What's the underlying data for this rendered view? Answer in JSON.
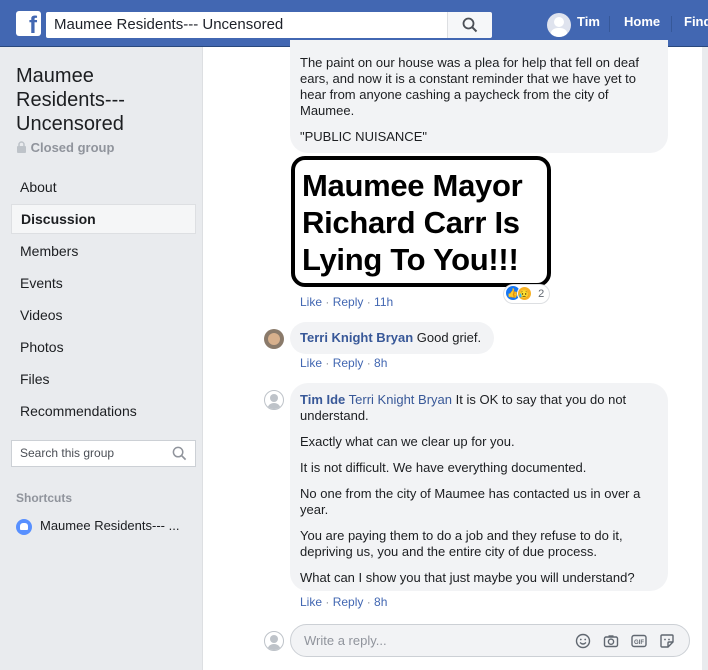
{
  "topbar": {
    "logo": "f",
    "search_value": "Maumee Residents--- Uncensored",
    "user_name": "Tim",
    "nav_home": "Home",
    "nav_find": "Find"
  },
  "sidebar": {
    "group_name": "Maumee Residents--- Uncensored",
    "privacy": "Closed group",
    "items": [
      {
        "label": "About"
      },
      {
        "label": "Discussion"
      },
      {
        "label": "Members"
      },
      {
        "label": "Events"
      },
      {
        "label": "Videos"
      },
      {
        "label": "Photos"
      },
      {
        "label": "Files"
      },
      {
        "label": "Recommendations"
      }
    ],
    "search_placeholder": "Search this group",
    "shortcuts_heading": "Shortcuts",
    "shortcut_item": "Maumee Residents--- ..."
  },
  "comments": {
    "first": {
      "paragraph_1": "The paint on our house was a plea for help that fell on deaf ears, and now it is a constant reminder that we have yet to hear from anyone cashing a paycheck from the city of Maumee.",
      "paragraph_2": "\"PUBLIC NUISANCE\"",
      "sticker_text": "Maumee Mayor Richard Carr Is Lying To You!!!",
      "like": "Like",
      "reply": "Reply",
      "time": "11h",
      "reaction_count": "2"
    },
    "second": {
      "author": "Terri Knight Bryan",
      "text": "Good grief.",
      "like": "Like",
      "reply": "Reply",
      "time": "8h"
    },
    "third": {
      "author": "Tim Ide",
      "tag": "Terri Knight Bryan",
      "lines": [
        "It is OK to say that you do not understand.",
        "Exactly what can we clear up for you.",
        "It is not difficult. We have everything documented.",
        "No one from the city of Maumee has contacted us in over a year.",
        "You are paying them to do a job and they refuse to do it, depriving us, you and the entire city of due process.",
        "What can I show you that just maybe you will understand?"
      ],
      "like": "Like",
      "reply": "Reply",
      "time": "8h"
    }
  },
  "reply_box": {
    "placeholder": "Write a reply..."
  },
  "colors": {
    "brand_blue": "#4267b2",
    "link_blue": "#385898",
    "bubble_gray": "#f2f3f5"
  },
  "icons": [
    "facebook-logo-icon",
    "search-icon",
    "closed-lock-icon",
    "group-icon",
    "like-reaction-icon",
    "sad-reaction-icon",
    "emoji-icon",
    "camera-icon",
    "gif-icon",
    "sticker-icon"
  ]
}
